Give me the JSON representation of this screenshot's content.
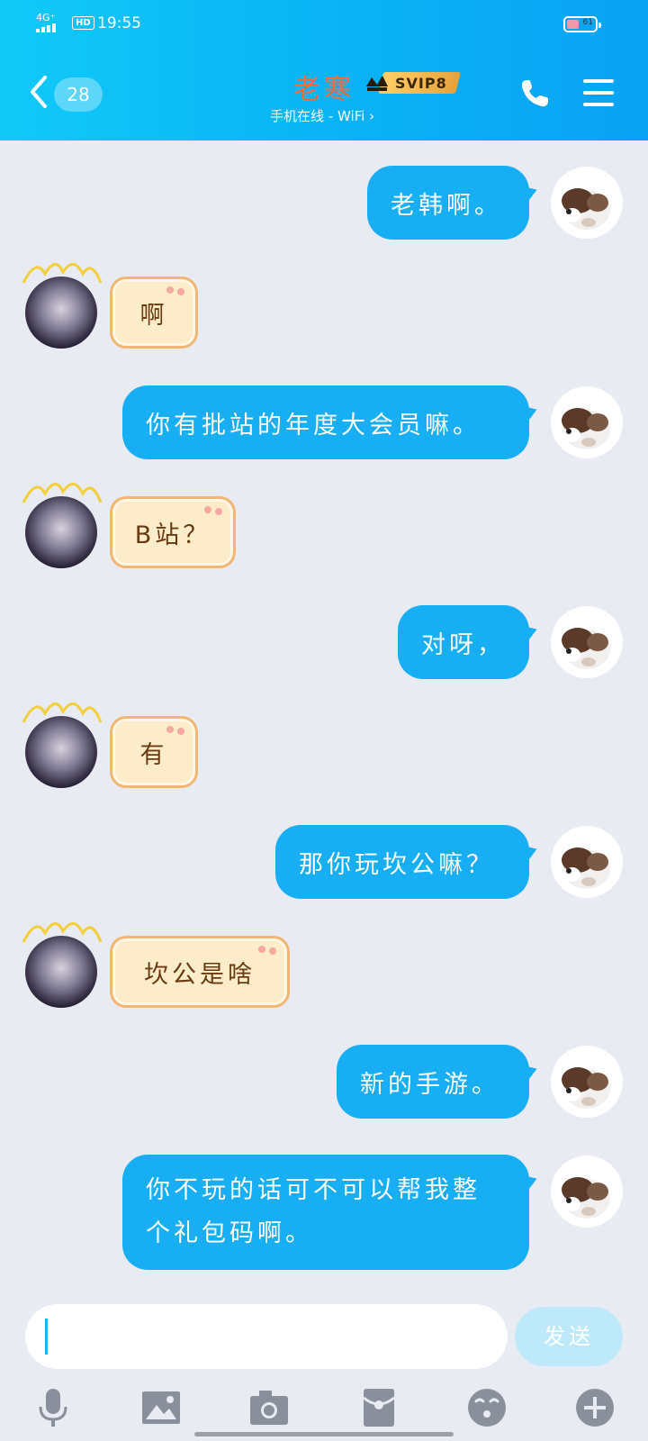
{
  "status_bar": {
    "network": "4G⁺",
    "hd": "HD",
    "time": "19:55",
    "battery": "61"
  },
  "header": {
    "unread_count": "28",
    "contact_name": "老寒",
    "vip_badge": "SVIP8",
    "status": "手机在线 - WiFi ›"
  },
  "messages": [
    {
      "side": "out",
      "text": "老韩啊。"
    },
    {
      "side": "in",
      "text": "啊"
    },
    {
      "side": "out",
      "text": "你有批站的年度大会员嘛。"
    },
    {
      "side": "in",
      "text": "B站？"
    },
    {
      "side": "out",
      "text": "对呀，"
    },
    {
      "side": "in",
      "text": "有"
    },
    {
      "side": "out",
      "text": "那你玩坎公嘛？"
    },
    {
      "side": "in",
      "text": "坎公是啥"
    },
    {
      "side": "out",
      "text": "新的手游。"
    },
    {
      "side": "out",
      "text": "你不玩的话可不可以帮我整个礼包码啊。"
    }
  ],
  "composer": {
    "input_value": "",
    "send_label": "发送"
  },
  "toolbar": [
    "mic-icon",
    "image-icon",
    "camera-icon",
    "red-packet-icon",
    "emoji-icon",
    "plus-icon"
  ],
  "colors": {
    "header_start": "#11c9f7",
    "header_end": "#0aa2f3",
    "outgoing_bubble": "#17aef3",
    "incoming_bubble": "#fdecca",
    "background": "#e9ebf2"
  }
}
